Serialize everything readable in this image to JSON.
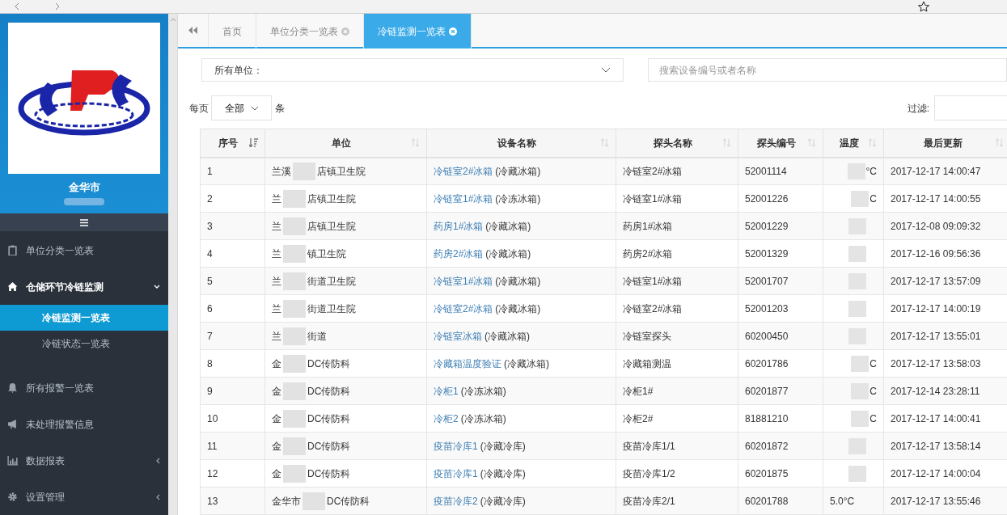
{
  "sidebar": {
    "city": "金华市",
    "menu": [
      {
        "kind": "item",
        "label": "单位分类一览表"
      },
      {
        "kind": "group",
        "label": "仓储环节冷链监测",
        "expanded": true,
        "children": [
          {
            "label": "冷链监测一览表",
            "selected": true
          },
          {
            "label": "冷链状态一览表",
            "selected": false
          }
        ]
      },
      {
        "kind": "item",
        "label": "所有报警一览表"
      },
      {
        "kind": "item",
        "label": "未处理报警信息"
      },
      {
        "kind": "group",
        "label": "数据报表",
        "expanded": false
      },
      {
        "kind": "group",
        "label": "设置管理",
        "expanded": false
      }
    ]
  },
  "tabs": [
    {
      "label": "首页",
      "closable": false,
      "selected": false
    },
    {
      "label": "单位分类一览表",
      "closable": true,
      "selected": false
    },
    {
      "label": "冷链监测一览表",
      "closable": true,
      "selected": true
    }
  ],
  "filters": {
    "unit_select": "所有单位：",
    "search": {
      "placeholder": "搜索设备编号或者名称"
    }
  },
  "page_size": {
    "prefix": "每页",
    "value": "全部",
    "suffix": "条"
  },
  "filter_label": "过滤:",
  "table": {
    "columns": [
      {
        "label": "序号",
        "sorted": true
      },
      {
        "label": "单位",
        "sorted": false
      },
      {
        "label": "设备名称",
        "sorted": false
      },
      {
        "label": "探头名称",
        "sorted": false
      },
      {
        "label": "探头编号",
        "sorted": false
      },
      {
        "label": "温度",
        "sorted": false
      },
      {
        "label": "最后更新",
        "sorted": false
      }
    ],
    "rows": [
      {
        "no": "1",
        "unit_start": "兰溪",
        "unit_end": "店镇卫生院",
        "device": "冷链室2#冰箱",
        "device_type": "(冷藏冰箱)",
        "probe": "冷链室2#冰箱",
        "probe_no": "52001114",
        "temp": "°C",
        "updated": "2017-12-17 14:00:47"
      },
      {
        "no": "2",
        "unit_start": "兰",
        "unit_end": "店镇卫生院",
        "device": "冷链室1#冰箱",
        "device_type": "(冷冻冰箱)",
        "probe": "冷链室1#冰箱",
        "probe_no": "52001226",
        "temp": "C",
        "updated": "2017-12-17 14:00:55"
      },
      {
        "no": "3",
        "unit_start": "兰",
        "unit_end": "店镇卫生院",
        "device": "药房1#冰箱",
        "device_type": "(冷藏冰箱)",
        "probe": "药房1#冰箱",
        "probe_no": "52001229",
        "updated": "2017-12-08 09:09:32"
      },
      {
        "no": "4",
        "unit_start": "兰",
        "unit_end": "镇卫生院",
        "device": "药房2#冰箱",
        "device_type": "(冷藏冰箱)",
        "probe": "药房2#冰箱",
        "probe_no": "52001329",
        "updated": "2017-12-16 09:56:36"
      },
      {
        "no": "5",
        "unit_start": "兰",
        "unit_end": "街道卫生院",
        "device": "冷链室1#冰箱",
        "device_type": "(冷藏冰箱)",
        "probe": "冷链室1#冰箱",
        "probe_no": "52001707",
        "updated": "2017-12-17 13:57:09"
      },
      {
        "no": "6",
        "unit_start": "兰",
        "unit_end": "街道卫生院",
        "device": "冷链室2#冰箱",
        "device_type": "(冷藏冰箱)",
        "probe": "冷链室2#冰箱",
        "probe_no": "52001203",
        "updated": "2017-12-17 14:00:19"
      },
      {
        "no": "7",
        "unit_start": "兰",
        "unit_end": "街道",
        "device": "冷链室冰箱",
        "device_type": "(冷藏冰箱)",
        "probe": "冷链室探头",
        "probe_no": "60200450",
        "updated": "2017-12-17 13:55:01"
      },
      {
        "no": "8",
        "unit_start": "金",
        "unit_end": "DC传防科",
        "device": "冷藏箱温度验证",
        "device_type": "(冷藏冰箱)",
        "probe": "冷藏箱测温",
        "probe_no": "60201786",
        "temp": "C",
        "updated": "2017-12-17 13:58:03"
      },
      {
        "no": "9",
        "unit_start": "金",
        "unit_end": "DC传防科",
        "device": "冷柜1",
        "device_type": "(冷冻冰箱)",
        "probe": "冷柜1#",
        "probe_no": "60201877",
        "temp": "C",
        "updated": "2017-12-14 23:28:11"
      },
      {
        "no": "10",
        "unit_start": "金",
        "unit_end": "DC传防科",
        "device": "冷柜2",
        "device_type": "(冷冻冰箱)",
        "probe": "冷柜2#",
        "probe_no": "81881210",
        "temp": "C",
        "updated": "2017-12-17 14:00:41"
      },
      {
        "no": "11",
        "unit_start": "金",
        "unit_end": "DC传防科",
        "device": "疫苗冷库1",
        "device_type": "(冷藏冷库)",
        "probe": "疫苗冷库1/1",
        "probe_no": "60201872",
        "updated": "2017-12-17 13:58:14"
      },
      {
        "no": "12",
        "unit_start": "金",
        "unit_end": "DC传防科",
        "device": "疫苗冷库1",
        "device_type": "(冷藏冷库)",
        "probe": "疫苗冷库1/2",
        "probe_no": "60201875",
        "updated": "2017-12-17 14:00:04"
      },
      {
        "no": "13",
        "unit_start": "金华市",
        "unit_end": "DC传防科",
        "device": "疫苗冷库2",
        "device_type": "(冷藏冷库)",
        "probe": "疫苗冷库2/1",
        "probe_no": "60201788",
        "temp": "5.0°C",
        "updated": "2017-12-17 13:55:46"
      }
    ]
  }
}
